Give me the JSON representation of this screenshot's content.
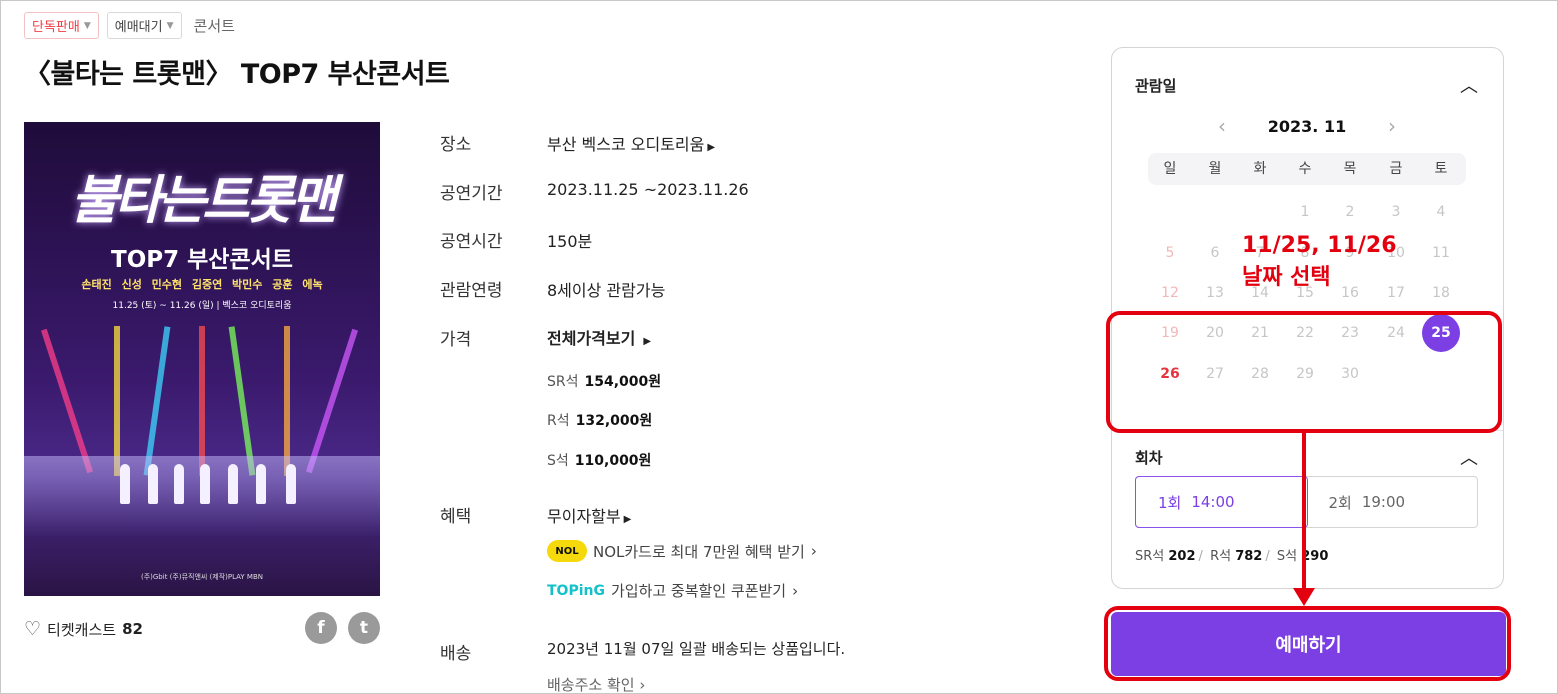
{
  "breadcrumb": {
    "chip1": "단독판매",
    "chip2": "예매대기",
    "category": "콘서트"
  },
  "title": "〈불타는 트롯맨〉 TOP7 부산콘서트",
  "poster": {
    "title": "불타는트롯맨",
    "subtitle": "TOP7 부산콘서트",
    "names": "손태진 신성 민수현 김중연 박민수 공훈 에녹",
    "date": "11.25 (토) ~ 11.26 (일) | 벡스코 오디토리움",
    "footer": "(주)Gbit  (주)뮤직앤씨  (제작)PLAY  MBN"
  },
  "ticketcast": {
    "label": "티켓캐스트",
    "count": "82"
  },
  "social": {
    "facebook": "f",
    "twitter": "t"
  },
  "info": {
    "venue_label": "장소",
    "venue": "부산 벡스코 오디토리움",
    "period_label": "공연기간",
    "period": "2023.11.25 ~2023.11.26",
    "runtime_label": "공연시간",
    "runtime": "150분",
    "age_label": "관람연령",
    "age": "8세이상 관람가능",
    "price_label": "가격",
    "price_all": "전체가격보기",
    "prices": [
      {
        "seat": "SR석",
        "price": "154,000원"
      },
      {
        "seat": "R석",
        "price": "132,000원"
      },
      {
        "seat": "S석",
        "price": "110,000원"
      }
    ],
    "benefit_label": "혜택",
    "benefit_main": "무이자할부",
    "nol_logo": "NOL",
    "nol_text": "NOL카드로 최대 7만원 혜택 받기",
    "toping_logo": "TOPinG",
    "toping_text": "가입하고 중복할인 쿠폰받기",
    "delivery_label": "배송",
    "delivery": "2023년 11월 07일 일괄 배송되는 상품입니다.",
    "delivery_link": "배송주소 확인"
  },
  "booking": {
    "date_header": "관람일",
    "month": "2023. 11",
    "weekdays": [
      "일",
      "월",
      "화",
      "수",
      "목",
      "금",
      "토"
    ],
    "selected_day": "25",
    "round_header": "회차",
    "rounds": [
      {
        "num": "1회",
        "time": "14:00"
      },
      {
        "num": "2회",
        "time": "19:00"
      }
    ],
    "seats": [
      {
        "seat": "SR석",
        "count": "202"
      },
      {
        "seat": "R석",
        "count": "782"
      },
      {
        "seat": "S석",
        "count": "290"
      }
    ],
    "book_button": "예매하기"
  },
  "annotation": {
    "line1": "11/25, 11/26",
    "line2": "날짜 선택"
  },
  "colors": {
    "accent": "#7b3fe4",
    "annotation": "#e3000f",
    "sunday": "#e5343f"
  }
}
